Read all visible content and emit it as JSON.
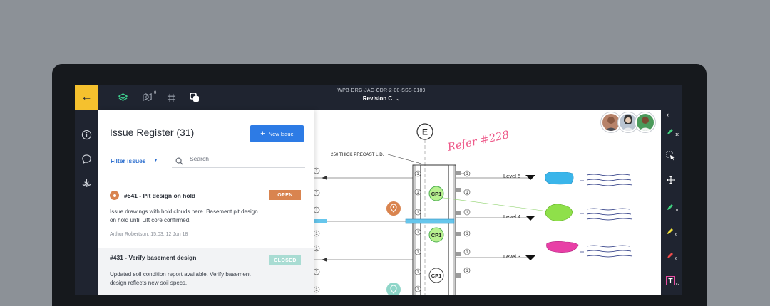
{
  "document": {
    "id": "WPB-DRG-JAC-CDR-2-00-SSS-0189",
    "revision": "Revision C"
  },
  "toolbar": {
    "markup_count": "9"
  },
  "panel": {
    "title": "Issue Register (31)",
    "new_issue_label": "New Issue",
    "filter_label": "Filter issues",
    "search_placeholder": "Search"
  },
  "issues": [
    {
      "title": "#541 - Pit design on hold",
      "status": "OPEN",
      "status_color": "#d9844f",
      "description": "Issue drawings with hold clouds here. Basement pit design on hold until Lift core confirmed.",
      "meta": "Arthur Robertson, 15:03, 12 Jun 18"
    },
    {
      "title": "#431 - Verify basement design",
      "status": "CLOSED",
      "status_color": "#a9dcd3",
      "description": "Updated soil condition report available. Verify basement design reflects new soil specs."
    }
  ],
  "drawing": {
    "gridline": "E",
    "annotation": "Refer #228",
    "slab_label": "250 THICK PRECAST LID.",
    "levels": [
      "Level 5",
      "Level 4",
      "Level 3"
    ],
    "cp_label": "CP1",
    "ref_number": "1"
  },
  "tools": [
    {
      "icon": "marker-green-icon",
      "count": "10"
    },
    {
      "icon": "marker-green-icon",
      "count": "10"
    },
    {
      "icon": "marker-yellow-icon",
      "count": "6"
    },
    {
      "icon": "marker-red-icon",
      "count": "6"
    },
    {
      "icon": "text-tool-icon",
      "count": "12"
    }
  ],
  "colors": {
    "accent": "#f5c12e",
    "primary": "#2d7be5",
    "open": "#d9844f",
    "closed": "#a9dcd3",
    "chrome": "#1f2430"
  }
}
